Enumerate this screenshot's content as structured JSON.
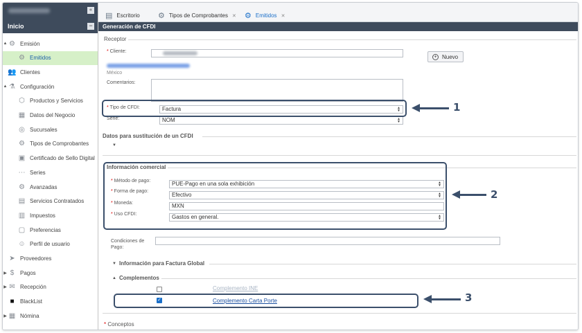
{
  "sidebar": {
    "home_label": "Inicio",
    "collapse_icon": "double-chevron-left-icon",
    "items": [
      {
        "label": "Emisión",
        "icon": "emision-icon",
        "arrow": "▲"
      },
      {
        "label": "Emitidos",
        "icon": "emitidos-icon",
        "arrow": ""
      },
      {
        "label": "Clientes",
        "icon": "users-icon",
        "arrow": ""
      },
      {
        "label": "Configuración",
        "icon": "org-chart-icon",
        "arrow": "▲"
      },
      {
        "label": "Productos y Servicios",
        "icon": "box-icon",
        "arrow": ""
      },
      {
        "label": "Datos del Negocio",
        "icon": "building-icon",
        "arrow": ""
      },
      {
        "label": "Sucursales",
        "icon": "pin-icon",
        "arrow": ""
      },
      {
        "label": "Tipos de Comprobantes",
        "icon": "doc-types-icon",
        "arrow": ""
      },
      {
        "label": "Certificado de Sello Digital",
        "icon": "certificate-icon",
        "arrow": ""
      },
      {
        "label": "Series",
        "icon": "series-icon",
        "arrow": ""
      },
      {
        "label": "Avanzadas",
        "icon": "gear-icon",
        "arrow": ""
      },
      {
        "label": "Servicios Contratados",
        "icon": "services-icon",
        "arrow": ""
      },
      {
        "label": "Impuestos",
        "icon": "tax-icon",
        "arrow": ""
      },
      {
        "label": "Preferencias",
        "icon": "preferences-icon",
        "arrow": ""
      },
      {
        "label": "Perfil de usuario",
        "icon": "user-profile-icon",
        "arrow": ""
      },
      {
        "label": "Proveedores",
        "icon": "truck-icon",
        "arrow": ""
      },
      {
        "label": "Pagos",
        "icon": "payments-icon",
        "arrow": "▶"
      },
      {
        "label": "Recepción",
        "icon": "inbox-icon",
        "arrow": "▶"
      },
      {
        "label": "BlackList",
        "icon": "blacklist-icon",
        "arrow": ""
      },
      {
        "label": "Nómina",
        "icon": "payroll-icon",
        "arrow": "▶"
      }
    ]
  },
  "tabs": [
    {
      "label": "Escritorio",
      "closable": false
    },
    {
      "label": "Tipos de Comprobantes",
      "closable": true
    },
    {
      "label": "Emitidos",
      "closable": true
    }
  ],
  "form": {
    "title": "Generación de CFDI",
    "receptor": {
      "legend": "Receptor",
      "cliente_label": "Cliente:",
      "country_text": "México",
      "comentarios_label": "Comentarios:",
      "nuevo_label": "Nuevo",
      "tipo_cfdi_label": "Tipo de CFDI:",
      "tipo_cfdi_value": "Factura",
      "serie_label": "Serie:",
      "serie_value": "NOM"
    },
    "sustitucion": {
      "legend": "Datos para sustitución de un CFDI"
    },
    "comercial": {
      "legend": "Información comercial",
      "metodo_label": "Método de pago:",
      "metodo_value": "PUE-Pago en una sola exhibición",
      "forma_label": "Forma de pago:",
      "forma_value": "Efectivo",
      "moneda_label": "Moneda:",
      "moneda_value": "MXN",
      "uso_label": "Uso CFDI:",
      "uso_value": "Gastos en general.",
      "condiciones_label": "Condiciones de Pago:"
    },
    "global": {
      "legend": "Información para Factura Global"
    },
    "complementos": {
      "legend": "Complementos",
      "items": [
        {
          "label": "Complemento INE",
          "checked": false
        },
        {
          "label": "Complemento Carta Porte",
          "checked": true
        }
      ]
    },
    "conceptos": {
      "legend": "Conceptos"
    }
  },
  "annotations": {
    "callout_1": "1",
    "callout_2": "2",
    "callout_3": "3",
    "color": "#3b4f6b"
  },
  "colors": {
    "header_bg": "#3e4b5c",
    "active_item_bg": "#d6f0c8",
    "link": "#1a4fa0"
  }
}
